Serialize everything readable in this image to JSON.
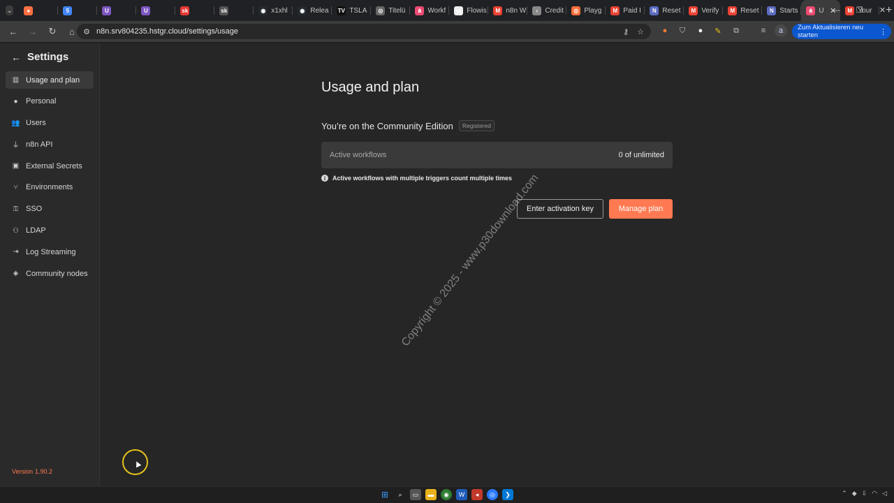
{
  "browser": {
    "tabs": [
      {
        "label": "",
        "color": "#ff7043",
        "glyph": "●"
      },
      {
        "label": "",
        "color": "#4285f4",
        "glyph": "5"
      },
      {
        "label": "",
        "color": "#7e57c2",
        "glyph": "U"
      },
      {
        "label": "",
        "color": "#7e57c2",
        "glyph": "U"
      },
      {
        "label": "",
        "color": "#e53935",
        "glyph": "sk"
      },
      {
        "label": "",
        "color": "#555555",
        "glyph": "sk"
      },
      {
        "label": "x1xhl",
        "color": "#24292f",
        "glyph": "◉"
      },
      {
        "label": "Relea",
        "color": "#24292f",
        "glyph": "◉"
      },
      {
        "label": "TSLA",
        "color": "#111111",
        "glyph": "TV"
      },
      {
        "label": "Titelü",
        "color": "#666666",
        "glyph": "◎"
      },
      {
        "label": "Workf",
        "color": "#ea4b71",
        "glyph": "⋔"
      },
      {
        "label": "Flowis",
        "color": "#eeeeee",
        "glyph": "▭"
      },
      {
        "label": "n8n W",
        "color": "#ea4335",
        "glyph": "M"
      },
      {
        "label": "Credit",
        "color": "#888888",
        "glyph": "‹"
      },
      {
        "label": "Playg",
        "color": "#ff6f3c",
        "glyph": "◎"
      },
      {
        "label": "Paid I",
        "color": "#ea4335",
        "glyph": "M"
      },
      {
        "label": "Reset",
        "color": "#5c6bc0",
        "glyph": "N"
      },
      {
        "label": "Verify",
        "color": "#ea4335",
        "glyph": "M"
      },
      {
        "label": "Reset",
        "color": "#ea4335",
        "glyph": "M"
      },
      {
        "label": "Starts",
        "color": "#5c6bc0",
        "glyph": "N"
      },
      {
        "label": "U",
        "color": "#ea4b71",
        "glyph": "⋔",
        "active": true
      },
      {
        "label": "Your",
        "color": "#ea4335",
        "glyph": "M"
      }
    ],
    "new_tab": "+",
    "url": "n8n.srv804235.hstgr.cloud/settings/usage",
    "update_button": "Zum Aktualisieren neu starten",
    "profile_initial": "a"
  },
  "sidebar": {
    "title": "Settings",
    "items": [
      {
        "label": "Usage and plan",
        "icon": "chart-icon",
        "glyph": "▥",
        "active": true
      },
      {
        "label": "Personal",
        "icon": "user-circle-icon",
        "glyph": "●"
      },
      {
        "label": "Users",
        "icon": "users-icon",
        "glyph": "👥"
      },
      {
        "label": "n8n API",
        "icon": "plug-icon",
        "glyph": "⏚"
      },
      {
        "label": "External Secrets",
        "icon": "vault-icon",
        "glyph": "▣"
      },
      {
        "label": "Environments",
        "icon": "branch-icon",
        "glyph": "⑂"
      },
      {
        "label": "SSO",
        "icon": "user-lock-icon",
        "glyph": "⚿"
      },
      {
        "label": "LDAP",
        "icon": "network-icon",
        "glyph": "⚇"
      },
      {
        "label": "Log Streaming",
        "icon": "sign-in-icon",
        "glyph": "⇥"
      },
      {
        "label": "Community nodes",
        "icon": "cube-icon",
        "glyph": "◈"
      }
    ],
    "version_label": "Version",
    "version_number": "1.90.2"
  },
  "main": {
    "title": "Usage and plan",
    "edition": "You’re on the Community Edition",
    "badge": "Registered",
    "usage_label": "Active workflows",
    "usage_value": "0 of unlimited",
    "note": "Active workflows with multiple triggers count multiple times",
    "activation_button": "Enter activation key",
    "manage_button": "Manage plan"
  },
  "watermark": "Copyright © 2025 - www.p30download.com",
  "colors": {
    "accent": "#ff7a52",
    "update_pill": "#0b57d0"
  }
}
